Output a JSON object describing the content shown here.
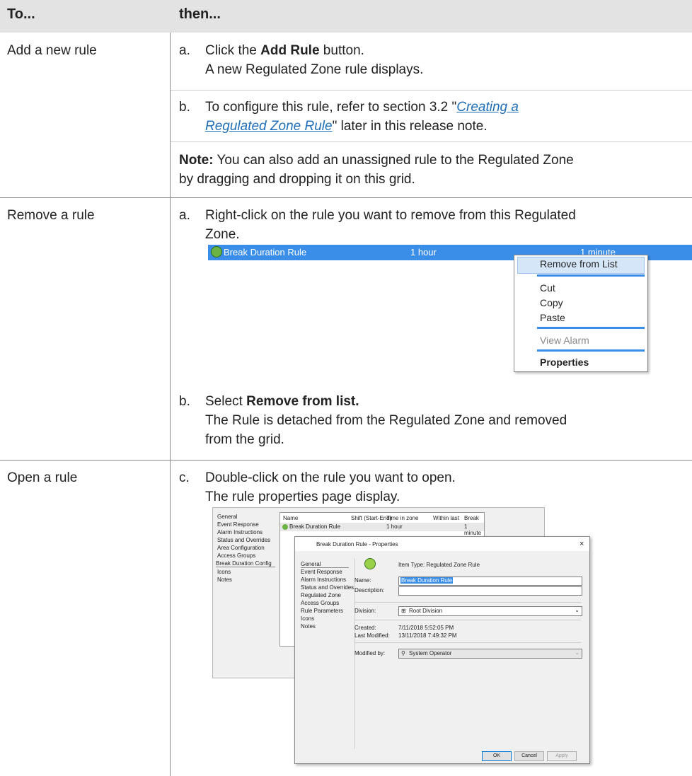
{
  "header": {
    "col1": "To...",
    "col2": "then..."
  },
  "rows": {
    "add": {
      "action": "Add a new rule",
      "step_a_letter": "a.",
      "step_a_pre": "Click the ",
      "step_a_bold": "Add Rule",
      "step_a_post": " button.",
      "step_a_result": "A new Regulated Zone rule displays.",
      "step_b_letter": "b.",
      "step_b_pre": "To configure this rule, refer to section 3.2 \"",
      "step_b_link1": "Creating a ",
      "step_b_link2": "Regulated Zone Rule",
      "step_b_post": "\" later in this release note.",
      "note_bold": "Note:",
      "note_line1": " You can also add an unassigned rule to the Regulated Zone",
      "note_line2": "by dragging and dropping it on this grid."
    },
    "remove": {
      "action": "Remove a rule",
      "step_a_letter": "a.",
      "step_a_line1": "Right-click on the rule you want to remove from this Regulated",
      "step_a_line2": "Zone.",
      "step_b_letter": "b.",
      "step_b_pre": "Select ",
      "step_b_bold": "Remove from list.",
      "step_b_line2": "The Rule is detached from the Regulated Zone and removed",
      "step_b_line3": "from the grid."
    },
    "open": {
      "action": "Open a rule",
      "step_c_letter": "c.",
      "step_c_line1": "Double-click on the rule you want to open.",
      "step_c_line2": "The rule properties page display."
    }
  },
  "context_screenshot": {
    "rule_name": "Break Duration Rule",
    "col2": "1 hour",
    "col3": "1 minute",
    "menu": {
      "remove": "Remove from List",
      "cut": "Cut",
      "copy": "Copy",
      "paste": "Paste",
      "view_alarm": "View Alarm",
      "properties": "Properties"
    }
  },
  "properties_screenshot": {
    "back_nav": [
      "General",
      "Event Response",
      "Alarm Instructions",
      "Status and Overrides",
      "Area Configuration",
      "Access Groups",
      "Break Duration Config",
      "Icons",
      "Notes"
    ],
    "list_headers": {
      "name": "Name",
      "shift": "Shift (Start-End)",
      "time": "Time in zone",
      "within": "Within last",
      "break": "Break"
    },
    "list_row": {
      "name": "Break Duration Rule",
      "time": "1 hour",
      "break": "1 minute"
    },
    "dialog_title": "Break Duration Rule - Properties",
    "close_glyph": "×",
    "dialog_nav": [
      "General",
      "Event Response",
      "Alarm Instructions",
      "Status and Overrides",
      "Regulated Zone",
      "Access Groups",
      "Rule Parameters",
      "Icons",
      "Notes"
    ],
    "item_type": "Item Type:  Regulated Zone Rule",
    "name_label": "Name:",
    "name_value": "Break Duration Rule",
    "description_label": "Description:",
    "division_label": "Division:",
    "division_value": "Root Division",
    "created_label": "Created:",
    "created_value": "7/11/2018 5:52:05 PM",
    "modified_label": "Last Modified:",
    "modified_value": "13/11/2018 7:49:32 PM",
    "modified_by_label": "Modified by:",
    "modified_by_value": "System Operator",
    "ok": "OK",
    "cancel": "Cancel",
    "apply": "Apply"
  }
}
